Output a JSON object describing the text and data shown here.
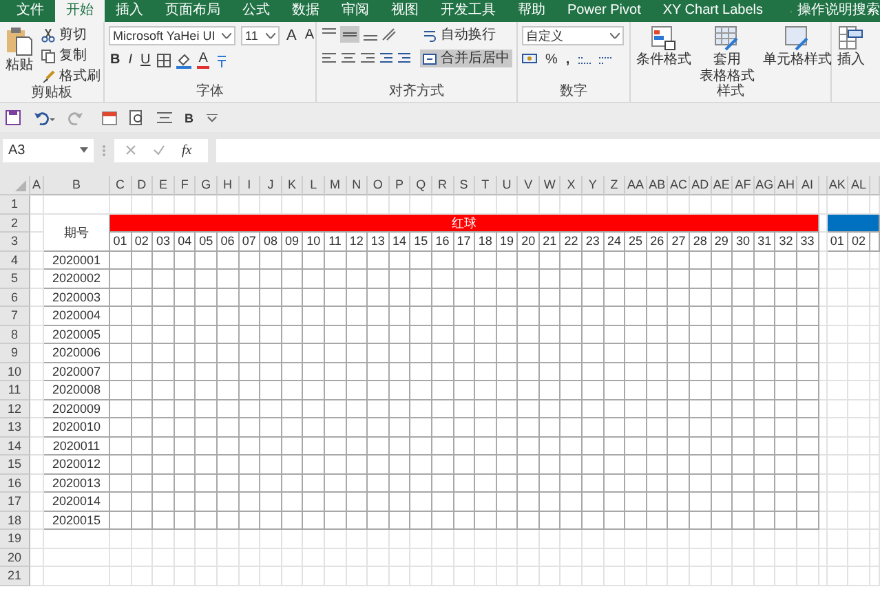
{
  "menu_tabs": [
    {
      "label": "文件",
      "selected": false
    },
    {
      "label": "开始",
      "selected": true
    },
    {
      "label": "插入",
      "selected": false
    },
    {
      "label": "页面布局",
      "selected": false
    },
    {
      "label": "公式",
      "selected": false
    },
    {
      "label": "数据",
      "selected": false
    },
    {
      "label": "审阅",
      "selected": false
    },
    {
      "label": "视图",
      "selected": false
    },
    {
      "label": "开发工具",
      "selected": false
    },
    {
      "label": "帮助",
      "selected": false
    },
    {
      "label": "Power Pivot",
      "selected": false
    },
    {
      "label": "XY Chart Labels",
      "selected": false
    }
  ],
  "tell_me": "操作说明搜索",
  "clipboard": {
    "paste": "粘贴",
    "cut": "剪切",
    "copy": "复制",
    "format_painter": "格式刷",
    "label": "剪贴板"
  },
  "font": {
    "family": "Microsoft YaHei UI",
    "size": "11",
    "grow": "A",
    "shrink": "A",
    "bold": "B",
    "italic": "I",
    "underline": "U",
    "color_button": "A",
    "label": "字体"
  },
  "alignment": {
    "wrap": "自动换行",
    "merge": "合并后居中",
    "merge_selected": true,
    "label": "对齐方式"
  },
  "number": {
    "format": "自定义",
    "percent": "%",
    "comma": ",",
    "label": "数字"
  },
  "styles": {
    "conditional": "条件格式",
    "table_line1": "套用",
    "table_line2": "表格格式",
    "cell_styles": "单元格样式",
    "label": "样式"
  },
  "cells": {
    "insert": "插入"
  },
  "quick_access": {
    "bold": "B"
  },
  "formula_bar": {
    "name_box": "A3",
    "fx": "fx"
  },
  "sheet": {
    "column_letters": [
      "A",
      "B",
      "C",
      "D",
      "E",
      "F",
      "G",
      "H",
      "I",
      "J",
      "K",
      "L",
      "M",
      "N",
      "O",
      "P",
      "Q",
      "R",
      "S",
      "T",
      "U",
      "V",
      "W",
      "X",
      "Y",
      "Z",
      "AA",
      "AB",
      "AC",
      "AD",
      "AE",
      "AF",
      "AG",
      "AH",
      "AI",
      "AK",
      "AL"
    ],
    "row_numbers": [
      "1",
      "2",
      "3",
      "4",
      "5",
      "6",
      "7",
      "8",
      "9",
      "10",
      "11",
      "12",
      "13",
      "14",
      "15",
      "16",
      "17",
      "18",
      "19",
      "20",
      "21"
    ],
    "period_label": "期号",
    "sections": [
      {
        "label": "红球",
        "color": "#ff0000",
        "numbers": [
          "01",
          "02",
          "03",
          "04",
          "05",
          "06",
          "07",
          "08",
          "09",
          "10",
          "11",
          "12",
          "13",
          "14",
          "15",
          "16",
          "17",
          "18",
          "19",
          "20",
          "21",
          "22",
          "23",
          "24",
          "25",
          "26",
          "27",
          "28",
          "29",
          "30",
          "31",
          "32",
          "33"
        ]
      },
      {
        "color": "#0070c0",
        "numbers": [
          "01",
          "02"
        ]
      }
    ],
    "periods": [
      "2020001",
      "2020002",
      "2020003",
      "2020004",
      "2020005",
      "2020006",
      "2020007",
      "2020008",
      "2020009",
      "2020010",
      "2020011",
      "2020012",
      "2020013",
      "2020014",
      "2020015"
    ]
  }
}
